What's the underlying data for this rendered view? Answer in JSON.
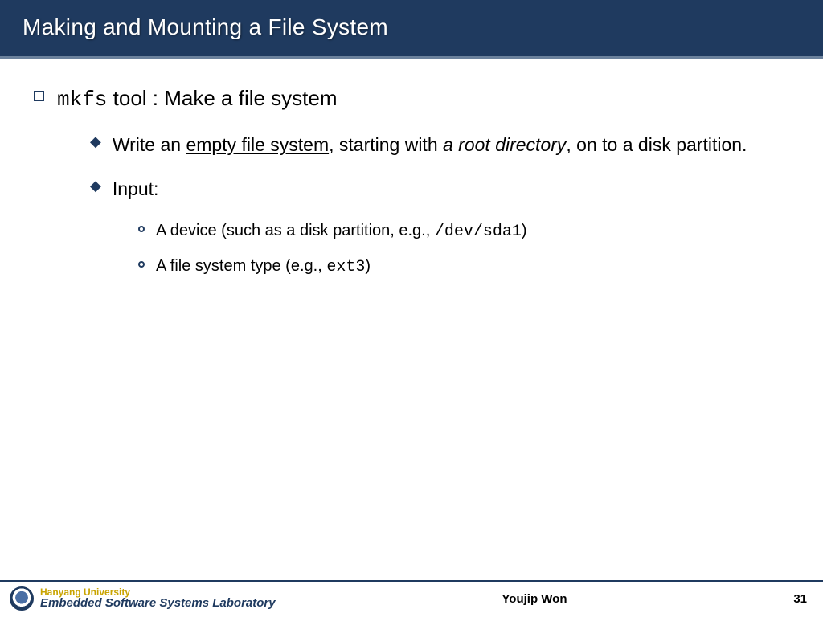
{
  "header": {
    "title": "Making and Mounting a File System"
  },
  "content": {
    "lvl1_code": "mkfs",
    "lvl1_rest": " tool : Make a file system",
    "lvl2a_pre": "Write an ",
    "lvl2a_under": "empty file system",
    "lvl2a_mid": ", starting with ",
    "lvl2a_ital": "a root directory",
    "lvl2a_post": ", on to a disk partition.",
    "lvl2b": "Input:",
    "lvl3a_pre": "A device (such as a disk partition, e.g., ",
    "lvl3a_code": "/dev/sda1",
    "lvl3a_post": ")",
    "lvl3b_pre": "A file system type (e.g., ",
    "lvl3b_code": "ext3",
    "lvl3b_post": ")"
  },
  "footer": {
    "university": "Hanyang University",
    "lab": "Embedded Software Systems Laboratory",
    "author": "Youjip Won",
    "page": "31"
  }
}
